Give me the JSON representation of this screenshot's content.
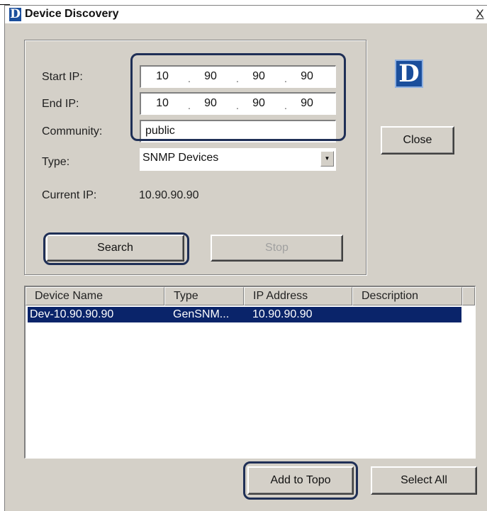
{
  "window": {
    "title": "Device Discovery",
    "close_glyph": "X",
    "logo_letter": "D"
  },
  "form": {
    "start_ip_label": "Start IP:",
    "end_ip_label": "End IP:",
    "community_label": "Community:",
    "type_label": "Type:",
    "current_ip_label": "Current IP:",
    "start_ip": [
      "10",
      "90",
      "90",
      "90"
    ],
    "end_ip": [
      "10",
      "90",
      "90",
      "90"
    ],
    "community_value": "public",
    "type_value": "SNMP Devices",
    "current_ip_value": "10.90.90.90",
    "ip_separator": "."
  },
  "buttons": {
    "search_label": "Search",
    "stop_label": "Stop",
    "close_label": "Close",
    "add_to_topo_label": "Add to Topo",
    "select_all_label": "Select All"
  },
  "table": {
    "columns": [
      "Device Name",
      "Type",
      "IP Address",
      "Description"
    ],
    "rows": [
      {
        "device_name": "Dev-10.90.90.90",
        "type": "GenSNM...",
        "ip_address": "10.90.90.90",
        "description": ""
      }
    ]
  },
  "colors": {
    "dialog_bg": "#d4d0c8",
    "selection": "#0a246a",
    "highlight_outline": "#1f2f56",
    "brand_blue": "#1a4e9c"
  },
  "icons": {
    "title_logo": "dlink-logo-icon",
    "dropdown": "chevron-down-icon"
  }
}
